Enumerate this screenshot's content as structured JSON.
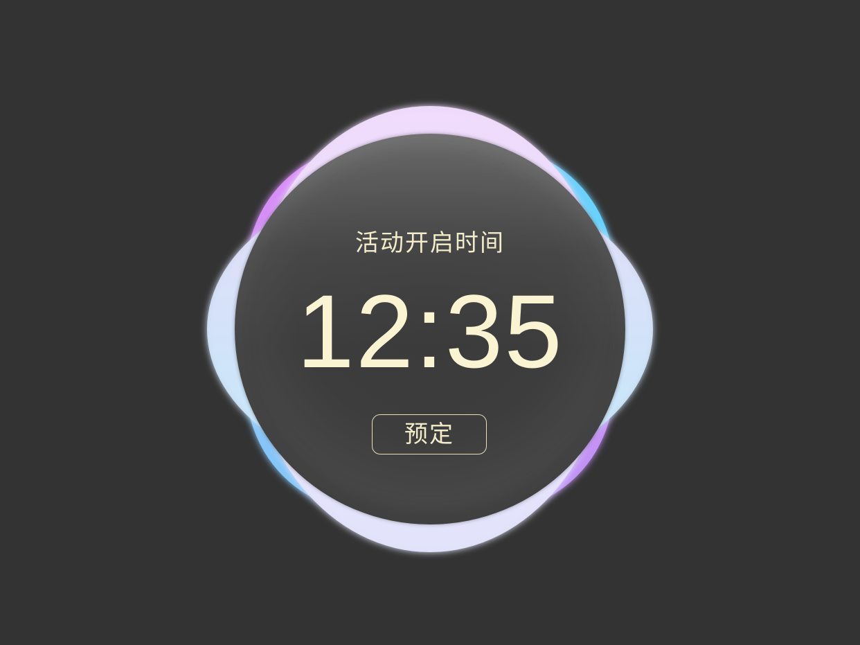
{
  "widget": {
    "title": "活动开启时间",
    "time": "12:35",
    "reserve_button_label": "预定"
  },
  "colors": {
    "background": "#333333",
    "text": "#f3ecc8",
    "petal_purple": "#e08af5",
    "petal_blue": "#66d2fb",
    "petal_lavender": "#ece0fb",
    "petal_cyan": "#b8f0fb"
  }
}
